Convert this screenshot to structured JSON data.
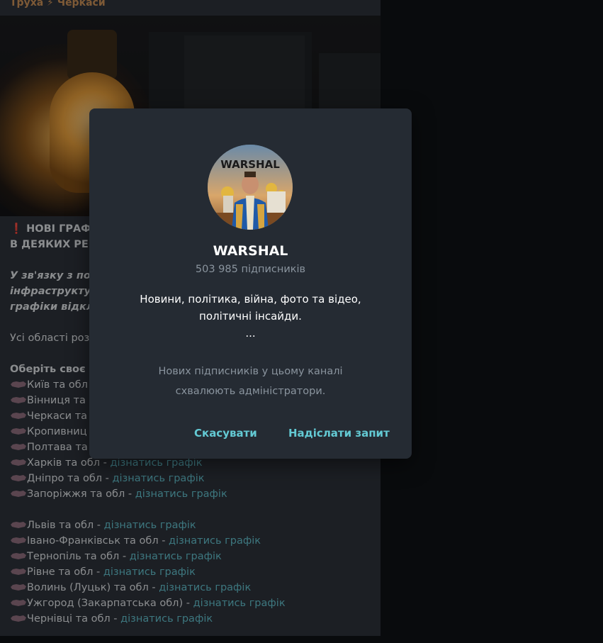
{
  "channel": {
    "name": "Труха ⚡ Черкаси"
  },
  "post": {
    "headline_1": "НОВІ ГРАФ",
    "headline_2": "В ДЕЯКИХ РЕГ",
    "italic_1": "У зв'язку з посі",
    "italic_2": "інфраструктуц",
    "italic_3": "графіки відклю",
    "regions_line": "Усі області роз",
    "choose_line": "Оберіть своє м",
    "partial_items": [
      "Київ та обл",
      "Вінниця та",
      "Черкаси та",
      "Кропивниц",
      "Полтава та"
    ],
    "link_text": "дізнатись графік",
    "items_group_1": [
      "Харків та обл - ",
      "Дніпро та обл - ",
      "Запоріжжя та обл - "
    ],
    "items_group_2": [
      "Львів та обл - ",
      "Івано-Франківськ та обл - ",
      "Тернопіль та обл - ",
      "Рівне та обл - ",
      "Волинь (Луцьк) та обл - ",
      "Ужгород (Закарпатська обл) - ",
      "Чернівці та обл - "
    ]
  },
  "dialog": {
    "avatar_text": "WARSHAL",
    "title": "WARSHAL",
    "subscribers": "503 985 підписників",
    "description_1": "Новини, політика, війна, фото та відео,",
    "description_2": "політичні інсайди.",
    "description_3": "...",
    "note_1": "Нових підписників у цьому каналі",
    "note_2": "схвалюють адміністратори.",
    "cancel_label": "Скасувати",
    "send_label": "Надіслати запит"
  },
  "colors": {
    "accent": "#63c9d3",
    "link": "#5fb7c3",
    "channel_name": "#c28a54",
    "modal_bg": "#252b33"
  }
}
